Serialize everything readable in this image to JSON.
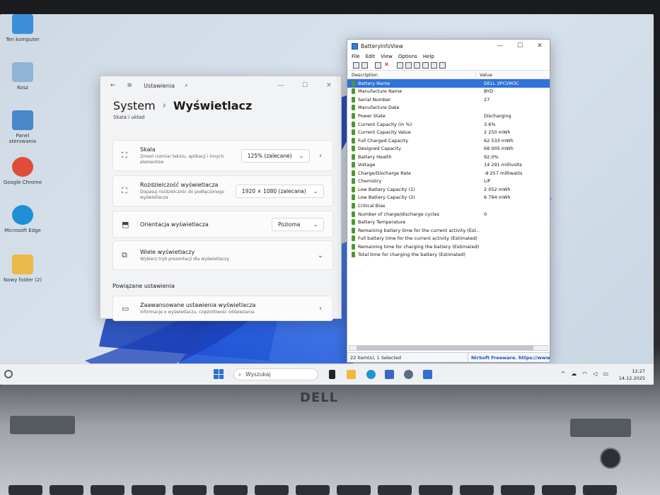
{
  "desktop": {
    "icons": [
      {
        "label": "Ten komputer",
        "icon": "computer-icon",
        "color": "#3d8fd8"
      },
      {
        "label": "Kosz",
        "icon": "recycle-bin-icon",
        "color": "#8fb4d4"
      },
      {
        "label": "Panel sterowania",
        "icon": "control-panel-icon",
        "color": "#4a86c9"
      },
      {
        "label": "Google Chrome",
        "icon": "chrome-icon",
        "color": "#e14b3b"
      },
      {
        "label": "Microsoft Edge",
        "icon": "edge-icon",
        "color": "#1f8fd6"
      },
      {
        "label": "Nowy folder (2)",
        "icon": "folder-icon",
        "color": "#e9b949"
      }
    ]
  },
  "settings": {
    "window_title": "Ustawienia",
    "breadcrumb_parent": "System",
    "breadcrumb_sep": "›",
    "breadcrumb_current": "Wyświetlacz",
    "section_cut": "Skala i układ",
    "cards": [
      {
        "title": "Skala",
        "subtitle": "Zmień rozmiar tekstu, aplikacji i innych elementów",
        "value": "125% (zalecane)",
        "chevron": "›",
        "icon": "scale-icon"
      },
      {
        "title": "Rozdzielczość wyświetlacza",
        "subtitle": "Dopasuj rozdzielczość do podłączonego wyświetlacza",
        "value": "1920 × 1080 (zalecana)",
        "chevron": "",
        "icon": "resolution-icon"
      },
      {
        "title": "Orientacja wyświetlacza",
        "subtitle": "",
        "value": "Pozioma",
        "chevron": "",
        "icon": "orientation-icon"
      },
      {
        "title": "Wiele wyświetlaczy",
        "subtitle": "Wybierz tryb prezentacji dla wyświetlaczy",
        "value": "",
        "chevron": "⌄",
        "icon": "multi-display-icon"
      }
    ],
    "related_heading": "Powiązane ustawienia",
    "advanced": {
      "title": "Zaawansowane ustawienia wyświetlacza",
      "subtitle": "Informacje o wyświetlaczu, częstotliwość odświeżania",
      "chevron": "›"
    }
  },
  "biv": {
    "title": "BatteryInfoView",
    "menu": [
      "File",
      "Edit",
      "View",
      "Options",
      "Help"
    ],
    "col_description": "Description",
    "col_value": "Value",
    "rows": [
      {
        "name": "Battery Name",
        "value": "DELL 3PCVM3C",
        "selected": true
      },
      {
        "name": "Manufacture Name",
        "value": "BYD"
      },
      {
        "name": "Serial Number",
        "value": "27"
      },
      {
        "name": "Manufacture Date",
        "value": ""
      },
      {
        "name": "Power State",
        "value": "Discharging"
      },
      {
        "name": "Current Capacity (in %)",
        "value": "3.6%"
      },
      {
        "name": "Current Capacity Value",
        "value": "2 250 mWh"
      },
      {
        "name": "Full Charged Capacity",
        "value": "62 533 mWh"
      },
      {
        "name": "Designed Capacity",
        "value": "68 005 mWh"
      },
      {
        "name": "Battery Health",
        "value": "92.0%"
      },
      {
        "name": "Voltage",
        "value": "14 291 millivolts"
      },
      {
        "name": "Charge/Discharge Rate",
        "value": "-9 257 milliwatts"
      },
      {
        "name": "Chemistry",
        "value": "LiP"
      },
      {
        "name": "Low Battery Capacity (1)",
        "value": "2 052 mWh"
      },
      {
        "name": "Low Battery Capacity (2)",
        "value": "6 794 mWh"
      },
      {
        "name": "Critical Bias",
        "value": ""
      },
      {
        "name": "Number of charge/discharge cycles",
        "value": "0"
      },
      {
        "name": "Battery Temperature",
        "value": ""
      },
      {
        "name": "Remaining battery time for the current activity (Est...",
        "value": ""
      },
      {
        "name": "Full battery time for the current activity (Estimated)",
        "value": ""
      },
      {
        "name": "Remaining time for charging the battery (Estimated)",
        "value": ""
      },
      {
        "name": "Total  time for charging the battery (Estimated)",
        "value": ""
      }
    ],
    "status_left": "22 item(s), 1 Selected",
    "status_right": "NirSoft Freeware. https://www.n"
  },
  "taskbar": {
    "search_placeholder": "Wyszukaj",
    "time": "12:27",
    "date": "14.12.2025",
    "apps": [
      {
        "icon": "task-view-icon",
        "color": "#1f2227"
      },
      {
        "icon": "file-explorer-icon",
        "color": "#f0b93a"
      },
      {
        "icon": "edge-icon",
        "color": "#1e93d5"
      },
      {
        "icon": "store-icon",
        "color": "#3a67c4"
      },
      {
        "icon": "settings-gear-icon",
        "color": "#5d6d80"
      },
      {
        "icon": "batteryinfoview-icon",
        "color": "#2f6fd0"
      }
    ]
  },
  "brand": {
    "logo": "DELL"
  }
}
